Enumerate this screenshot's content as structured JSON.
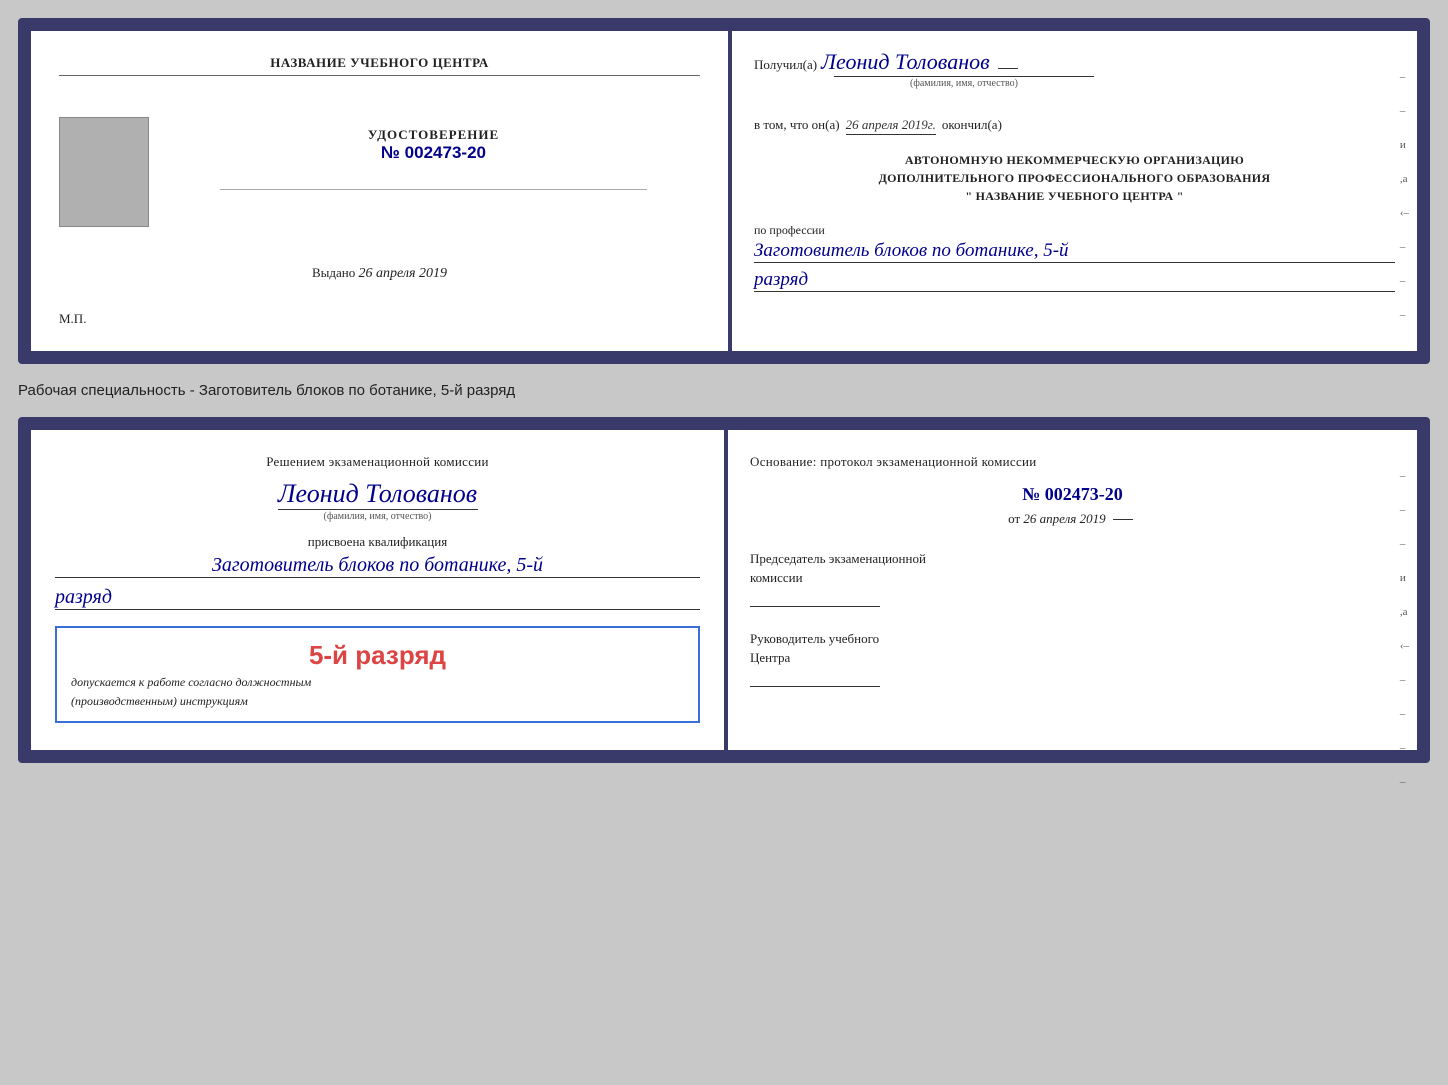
{
  "top_cert": {
    "left": {
      "school_title": "НАЗВАНИЕ УЧЕБНОГО ЦЕНТРА",
      "photo_alt": "photo",
      "udostoverenie_label": "УДОСТОВЕРЕНИЕ",
      "number": "№ 002473-20",
      "vydano_prefix": "Выдано",
      "vydano_date": "26 апреля 2019",
      "mp_label": "М.П."
    },
    "right": {
      "poluchil_prefix": "Получил(а)",
      "recipient_name": "Леонид Толованов",
      "fio_label": "(фамилия, имя, отчество)",
      "vtom_prefix": "в том, что он(а)",
      "vtom_date": "26 апреля 2019г.",
      "okonchill": "окончил(а)",
      "org_line1": "АВТОНОМНУЮ НЕКОММЕРЧЕСКУЮ ОРГАНИЗАЦИЮ",
      "org_line2": "ДОПОЛНИТЕЛЬНОГО ПРОФЕССИОНАЛЬНОГО ОБРАЗОВАНИЯ",
      "org_quote": "\"  НАЗВАНИЕ УЧЕБНОГО ЦЕНТРА  \"",
      "po_professii": "по профессии",
      "profession": "Заготовитель блоков по ботанике, 5-й",
      "razryad": "разряд"
    }
  },
  "specialty_label": "Рабочая специальность - Заготовитель блоков по ботанике, 5-й разряд",
  "bottom_cert": {
    "left": {
      "resheniem": "Решением экзаменационной комиссии",
      "name": "Леонид Толованов",
      "fio_label": "(фамилия, имя, отчество)",
      "prisvoena": "присвоена квалификация",
      "qual": "Заготовитель блоков по ботанике, 5-й",
      "razryad": "разряд",
      "stamp_razryad": "5-й разряд",
      "dopuskaetsya": "допускается к",
      "rabote": "работе согласно должностным",
      "instruktsiyam": "(производственным) инструкциям"
    },
    "right": {
      "osnovanie": "Основание: протокол экзаменационной комиссии",
      "protocol_num": "№  002473-20",
      "ot_prefix": "от",
      "ot_date": "26 апреля 2019",
      "predsedatel_label": "Председатель экзаменационной",
      "predsedatel_label2": "комиссии",
      "rukovoditel_label": "Руководитель учебного",
      "rukovoditel_label2": "Центра"
    }
  }
}
